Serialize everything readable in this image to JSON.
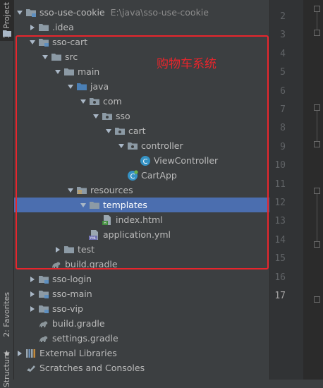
{
  "sidebar_tabs": {
    "project": "1: Project",
    "favorites": "2: Favorites",
    "structure": "Structure"
  },
  "annotation": "购物车系统",
  "tree": [
    {
      "name": "sso-use-cookie",
      "path": "E:\\java\\sso-use-cookie",
      "depth": 0,
      "expanded": true,
      "icon": "module-folder"
    },
    {
      "name": ".idea",
      "depth": 1,
      "expanded": false,
      "icon": "folder"
    },
    {
      "name": "sso-cart",
      "depth": 1,
      "expanded": true,
      "icon": "module-folder"
    },
    {
      "name": "src",
      "depth": 2,
      "expanded": true,
      "icon": "folder"
    },
    {
      "name": "main",
      "depth": 3,
      "expanded": true,
      "icon": "folder"
    },
    {
      "name": "java",
      "depth": 4,
      "expanded": true,
      "icon": "source-folder"
    },
    {
      "name": "com",
      "depth": 5,
      "expanded": true,
      "icon": "package"
    },
    {
      "name": "sso",
      "depth": 6,
      "expanded": true,
      "icon": "package"
    },
    {
      "name": "cart",
      "depth": 7,
      "expanded": true,
      "icon": "package"
    },
    {
      "name": "controller",
      "depth": 8,
      "expanded": true,
      "icon": "package"
    },
    {
      "name": "ViewController",
      "depth": 9,
      "icon": "java-class"
    },
    {
      "name": "CartApp",
      "depth": 8,
      "icon": "spring-boot-class"
    },
    {
      "name": "resources",
      "depth": 4,
      "expanded": true,
      "icon": "resources-folder"
    },
    {
      "name": "templates",
      "depth": 5,
      "expanded": true,
      "icon": "folder",
      "selected": true
    },
    {
      "name": "index.html",
      "depth": 6,
      "icon": "html-file"
    },
    {
      "name": "application.yml",
      "depth": 5,
      "icon": "yml-file"
    },
    {
      "name": "test",
      "depth": 3,
      "expanded": false,
      "icon": "folder"
    },
    {
      "name": "build.gradle",
      "depth": 2,
      "icon": "gradle-file"
    },
    {
      "name": "sso-login",
      "depth": 1,
      "expanded": false,
      "icon": "module-folder"
    },
    {
      "name": "sso-main",
      "depth": 1,
      "expanded": false,
      "icon": "module-folder"
    },
    {
      "name": "sso-vip",
      "depth": 1,
      "expanded": false,
      "icon": "module-folder"
    },
    {
      "name": "build.gradle",
      "depth": 1,
      "icon": "gradle-file"
    },
    {
      "name": "settings.gradle",
      "depth": 1,
      "icon": "gradle-file"
    },
    {
      "name": "External Libraries",
      "depth": 0,
      "expanded": false,
      "icon": "libraries"
    },
    {
      "name": "Scratches and Consoles",
      "depth": 0,
      "icon": "scratches"
    }
  ],
  "line_numbers": [
    "2",
    "3",
    "4",
    "5",
    "6",
    "7",
    "8",
    "9",
    "10",
    "11",
    "12",
    "13",
    "14",
    "15",
    "16",
    "17"
  ],
  "current_line": "17",
  "colors": {
    "panel_bg": "#3c3f41",
    "selection": "#4b6eaf",
    "annotation_red": "#e8252c",
    "text": "#bbbbbb",
    "folder": "#8c9aa5",
    "source_folder": "#4a7fb5",
    "class_blue": "#3592c4"
  }
}
